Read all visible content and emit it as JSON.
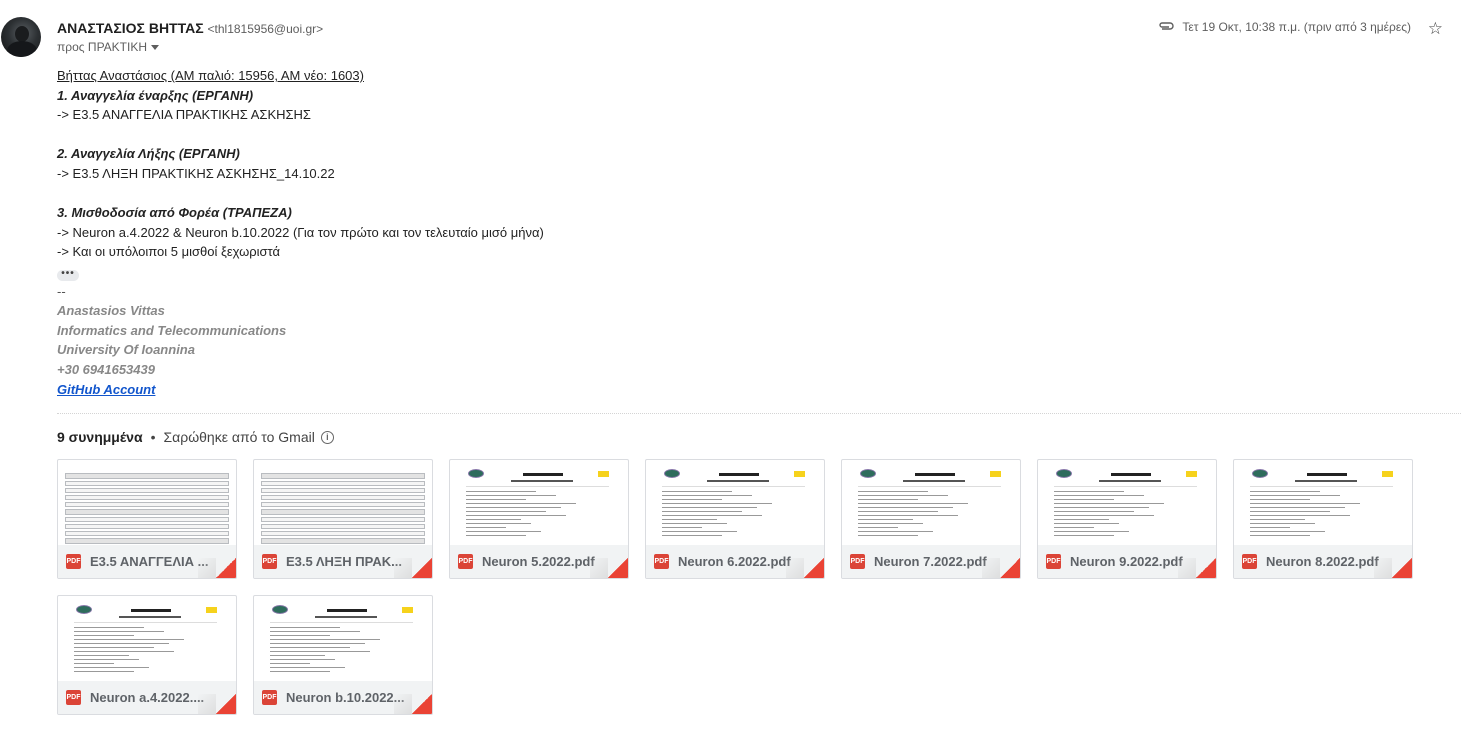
{
  "sender": {
    "name": "ΑΝΑΣΤΑΣΙΟΣ ΒΗΤΤΑΣ",
    "email": "<thl1815956@uoi.gr>",
    "recipient": "προς ΠΡΑΚΤΙΚΗ",
    "date": "Τετ 19 Οκτ, 10:38 π.μ. (πριν από 3 ημέρες)"
  },
  "icons": {
    "attachment": "paperclip-icon",
    "star": "star-icon",
    "recipients_toggle": "chevron-down-icon",
    "info": "info-icon",
    "file": "pdf-icon"
  },
  "body": {
    "heading": "Βήττας Αναστάσιος (ΑΜ παλιό: 15956, ΑΜ νέο: 1603)",
    "s1_title": "1. Αναγγελία έναρξης (ΕΡΓΑΝΗ)",
    "s1_text": "-> Ε3.5 ΑΝΑΓΓΕΛΙΑ ΠΡΑΚΤΙΚΗΣ ΑΣΚΗΣΗΣ",
    "s2_title": "2. Αναγγελία Λήξης (ΕΡΓΑΝΗ)",
    "s2_text": "-> Ε3.5 ΛΗΞΗ ΠΡΑΚΤΙΚΗΣ ΑΣΚΗΣΗΣ_14.10.22",
    "s3_title": "3. Μισθοδοσία από Φορέα (ΤΡΑΠΕΖΑ)",
    "s3_text1": "-> Neuron a.4.2022 & Neuron b.10.2022 (Για τον πρώτο και τον τελευταίο μισό μήνα)",
    "s3_text2": "-> Και οι υπόλοιποι 5 μισθοί ξεχωριστά",
    "ellipsis": "•••"
  },
  "signature": {
    "dashes": "--",
    "name": "Anastasios Vittas",
    "dept": "Informatics and Telecommunications",
    "university": "University Of Ioannina",
    "phone": "+30 6941653439",
    "link": "GitHub Account"
  },
  "attachments": {
    "count_label": "9 συνημμένα",
    "separator": "•",
    "scan_label": "Σαρώθηκε από το Gmail",
    "info_glyph": "i",
    "pdf_label": "PDF",
    "files": [
      {
        "name": "Ε3.5 ΑΝΑΓΓΕΛΙΑ ...",
        "kind": "form"
      },
      {
        "name": "Ε3.5 ΛΗΞΗ ΠΡΑΚ...",
        "kind": "form"
      },
      {
        "name": "Neuron 5.2022.pdf",
        "kind": "bank"
      },
      {
        "name": "Neuron 6.2022.pdf",
        "kind": "bank"
      },
      {
        "name": "Neuron 7.2022.pdf",
        "kind": "bank"
      },
      {
        "name": "Neuron 9.2022.pdf",
        "kind": "bank"
      },
      {
        "name": "Neuron 8.2022.pdf",
        "kind": "bank"
      },
      {
        "name": "Neuron a.4.2022....",
        "kind": "bank"
      },
      {
        "name": "Neuron b.10.2022....",
        "kind": "bank"
      }
    ]
  }
}
